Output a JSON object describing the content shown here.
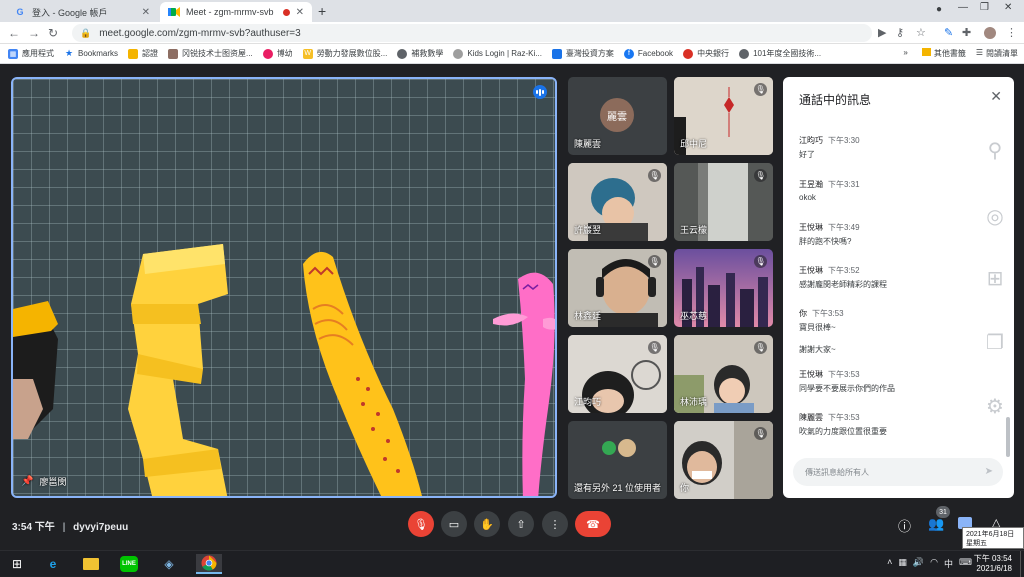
{
  "browser": {
    "tabs": [
      {
        "title": "登入 - Google 帳戶",
        "favicon": "google-g-icon",
        "active": false
      },
      {
        "title": "Meet - zgm-mrmv-svb",
        "favicon": "meet-icon",
        "active": true
      }
    ],
    "url": "meet.google.com/zgm-mrmv-svb?authuser=3",
    "bookmarks": [
      {
        "label": "應用程式",
        "color": "#4285f4"
      },
      {
        "label": "Bookmarks",
        "color": "#5f6368"
      },
      {
        "label": "認證",
        "color": "#f4b400"
      },
      {
        "label": "冈锐技术士图资屋...",
        "color": "#8d6e63"
      },
      {
        "label": "博幼",
        "color": "#e91e63"
      },
      {
        "label": "勞動力發展數位股...",
        "color": "#f6bf26"
      },
      {
        "label": "補救數學",
        "color": "#5f6368"
      },
      {
        "label": "Kids Login | Raz-Ki...",
        "color": "#9e9e9e"
      },
      {
        "label": "臺灣投資方案",
        "color": "#1a73e8"
      },
      {
        "label": "Facebook",
        "color": "#1877f2"
      },
      {
        "label": "中央銀行",
        "color": "#d93025"
      },
      {
        "label": "101年度全國技術...",
        "color": "#5f6368"
      }
    ],
    "bookmarks_right": [
      "其他書籤",
      "閱讀清單"
    ]
  },
  "meet": {
    "presenter": {
      "name": "廖邕閔"
    },
    "participants": [
      {
        "name": "陳麗雲",
        "avatar_text": "麗雲",
        "muted": false,
        "avatar_only": true
      },
      {
        "name": "邱中尼",
        "muted": true
      },
      {
        "name": "許巖翌",
        "muted": true
      },
      {
        "name": "王云檬",
        "muted": true
      },
      {
        "name": "林鑫廷",
        "muted": true
      },
      {
        "name": "巫芯慈",
        "muted": true
      },
      {
        "name": "江昀巧",
        "muted": true
      },
      {
        "name": "林沛瑀",
        "muted": true
      },
      {
        "name": "還有另外 21 位使用者",
        "muted": false
      },
      {
        "name": "你",
        "muted": true
      }
    ],
    "meeting_time": "3:54 下午",
    "meeting_code": "dyvyi7peuu",
    "people_count": "31",
    "colors": {
      "accent": "#8ab4f8",
      "hangup": "#ea4335",
      "speaking": "#1a73e8"
    }
  },
  "chat": {
    "title": "通話中的訊息",
    "messages": [
      {
        "sender": "江昀巧",
        "time": "下午3:30",
        "text": "好了"
      },
      {
        "sender": "王昱瀚",
        "time": "下午3:31",
        "text": "okok"
      },
      {
        "sender": "王悅琳",
        "time": "下午3:49",
        "text": "胖的跑不快嗎?"
      },
      {
        "sender": "王悅琳",
        "time": "下午3:52",
        "text": "感謝龐閔老師精彩的課程"
      },
      {
        "sender": "你",
        "time": "下午3:53",
        "text": "寶貝很棒~",
        "text2": "謝謝大家~"
      },
      {
        "sender": "王悅琳",
        "time": "下午3:53",
        "text": "同學要不要展示你們的作品"
      },
      {
        "sender": "陳麗雲",
        "time": "下午3:53",
        "text": "吹氣的力度跟位置很重要"
      }
    ],
    "input_placeholder": "傳送訊息給所有人"
  },
  "taskbar": {
    "clock_time": "下午 03:54",
    "clock_date": "2021/6/18",
    "tooltip_date": "2021年6月18日",
    "tooltip_day": "星期五"
  }
}
